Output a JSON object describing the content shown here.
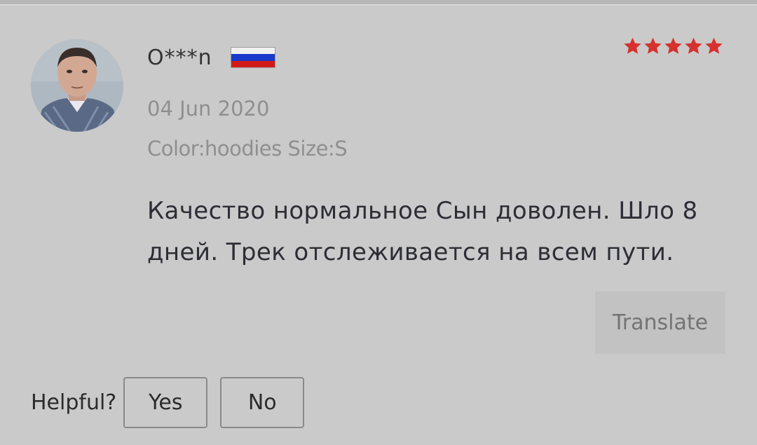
{
  "review": {
    "username": "O***n",
    "country_flag": "russia-flag-icon",
    "rating": 5,
    "rating_max": 5,
    "date": "04 Jun 2020",
    "sku": "Color:hoodies Size:S",
    "text": "Качество нормальное Сын доволен. Шло 8 дней. Трек отслеживается на всем пути.",
    "translate_label": "Translate"
  },
  "helpful": {
    "label": "Helpful?",
    "yes_label": "Yes",
    "no_label": "No"
  },
  "colors": {
    "star": "#d6312f",
    "background": "#cacaca",
    "flag_white": "#f0f0f0",
    "flag_blue": "#1a39c9",
    "flag_red": "#d21a1a"
  }
}
